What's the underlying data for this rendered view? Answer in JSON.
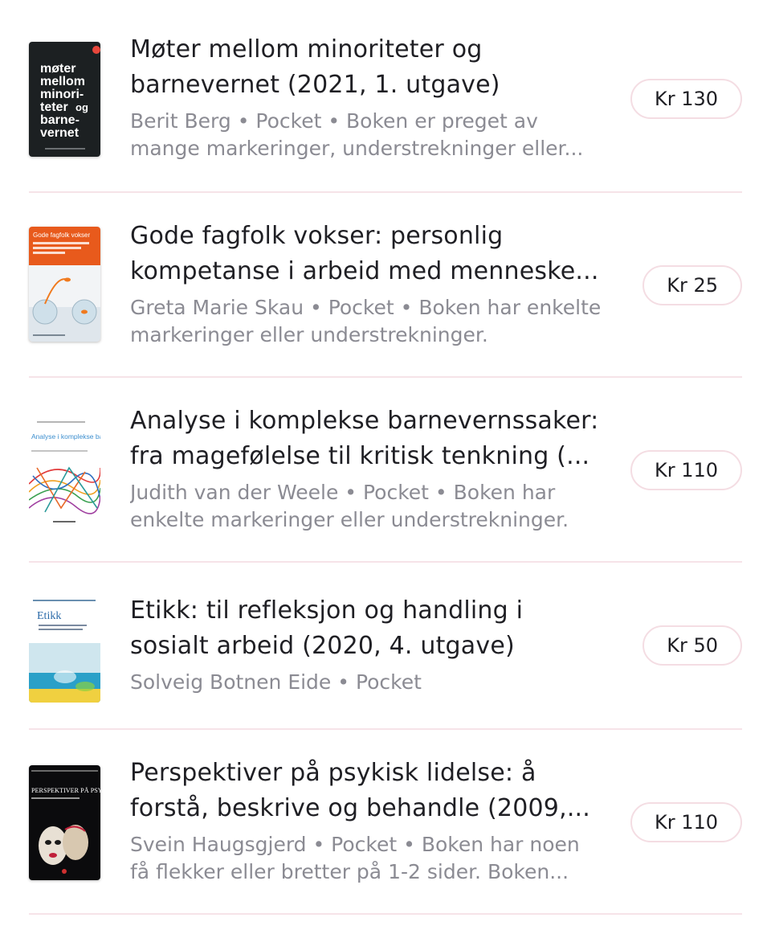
{
  "books": [
    {
      "title": "Møter mellom minoriteter og barnevernet (2021, 1. utgave)",
      "meta": "Berit Berg • Pocket • Boken er preget av mange markeringer, understrekninger eller...",
      "price": "Kr 130",
      "cover": {
        "lines": [
          "møter",
          "mellom",
          "minori-",
          "teter",
          "og",
          "barne-",
          "vernet"
        ],
        "bg": "#1c2022",
        "accent": "#e8473c"
      }
    },
    {
      "title": "Gode fagfolk vokser: personlig kompetanse i arbeid med menneske...",
      "meta": "Greta Marie Skau • Pocket • Boken har enkelte markeringer eller understrekninger.",
      "price": "Kr 25",
      "cover": {
        "header": "Gode fagfolk vokser",
        "bg": "#e85a1c"
      }
    },
    {
      "title": "Analyse i komplekse barnevernssaker: fra magefølelse til kritisk tenkning (...",
      "meta": "Judith van der Weele • Pocket • Boken har enkelte markeringer eller understrekninger.",
      "price": "Kr 110",
      "cover": {
        "header": "Analyse i komplekse barnevernssaker",
        "bg": "#ffffff"
      }
    },
    {
      "title": "Etikk: til refleksjon og handling i sosialt arbeid (2020, 4. utgave)",
      "meta": "Solveig Botnen Eide • Pocket",
      "price": "Kr 50",
      "cover": {
        "header": "Etikk",
        "bg": "#ffffff"
      }
    },
    {
      "title": "Perspektiver på psykisk lidelse: å forstå, beskrive og behandle (2009,...",
      "meta": "Svein Haugsgjerd • Pocket • Boken har noen få flekker eller bretter på 1-2 sider. Boken...",
      "price": "Kr 110",
      "cover": {
        "header": "PERSPEKTIVER PÅ PSYKISK LIDELSE",
        "bg": "#0b0b0d"
      }
    }
  ]
}
